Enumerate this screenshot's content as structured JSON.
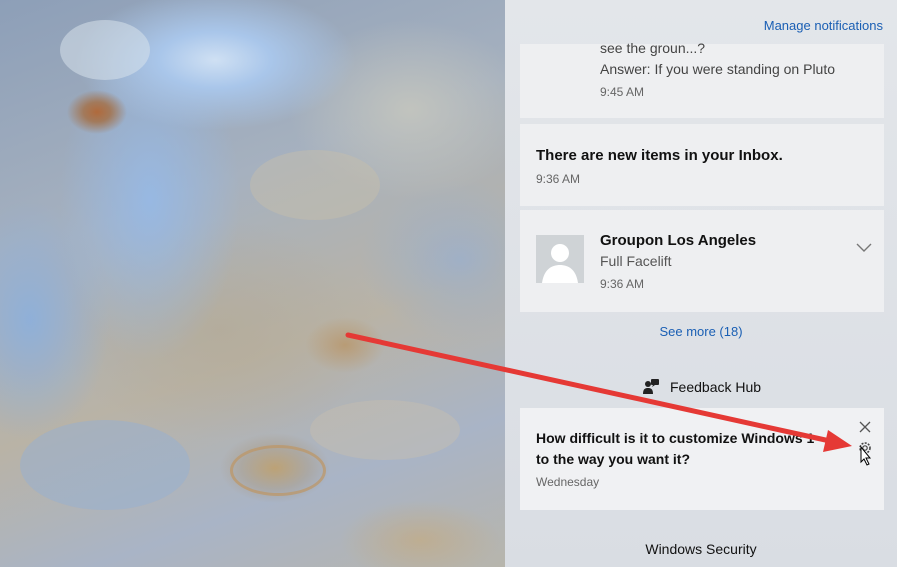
{
  "action_center": {
    "manage_link": "Manage notifications",
    "notifications": [
      {
        "line1": "see the groun...?",
        "line2": "Answer: If you were standing on Pluto",
        "time": "9:45 AM"
      },
      {
        "title": "There are new items in your Inbox.",
        "time": "9:36 AM"
      },
      {
        "title": "Groupon Los Angeles",
        "line": "Full Facelift",
        "time": "9:36 AM",
        "expand_icon": "chevron-down-icon"
      }
    ],
    "see_more": "See more (18)",
    "groups": {
      "feedback_hub": {
        "name": "Feedback Hub",
        "icon": "feedback-hub-icon",
        "notification": {
          "title_line1": "How difficult is it to customize Windows 10",
          "title_line2": "to the way you want it?",
          "time": "Wednesday",
          "close_icon": "close-icon",
          "settings_icon": "gear-icon"
        }
      },
      "windows_security": {
        "name": "Windows Security"
      }
    }
  },
  "colors": {
    "link": "#1a5fb4",
    "card": "#eeeff1",
    "panel": "#dfe2e6",
    "arrow": "#e53935"
  }
}
